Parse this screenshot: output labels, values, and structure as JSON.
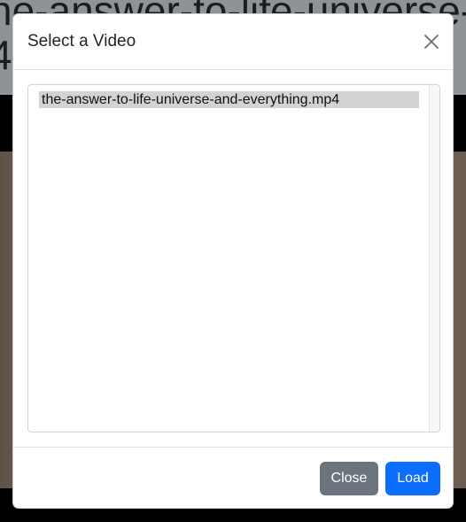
{
  "background": {
    "title_line1": "he-answer-to-life-universe-and-",
    "title_line2": "4"
  },
  "modal": {
    "title": "Select a Video",
    "close_icon": "close-icon",
    "files": [
      {
        "name": "the-answer-to-life-universe-and-everything.mp4",
        "selected": true
      }
    ],
    "buttons": {
      "close_label": "Close",
      "load_label": "Load"
    }
  },
  "colors": {
    "primary": "#0d6efd",
    "secondary": "#6c757d",
    "selection": "#d3d3d3"
  }
}
